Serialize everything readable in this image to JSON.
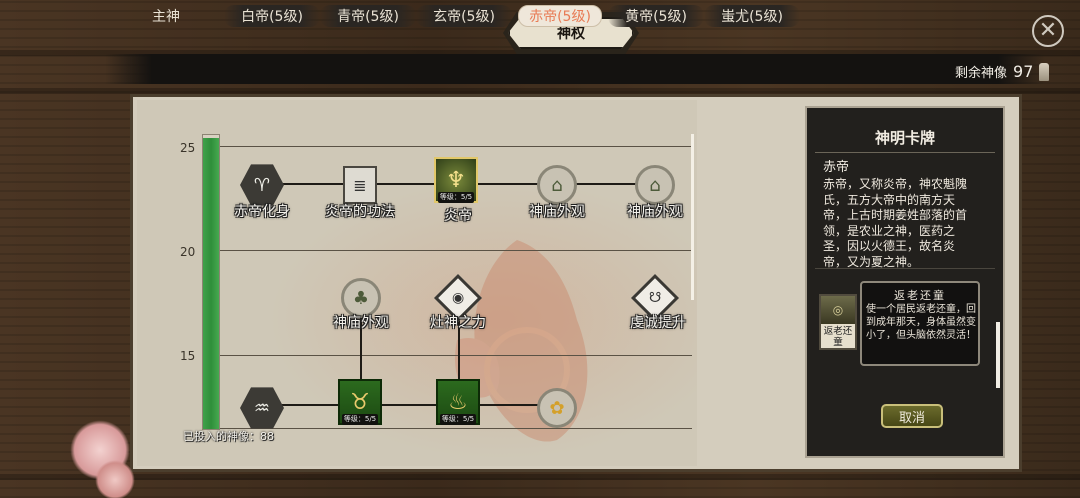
{
  "title": "神权",
  "tabs": [
    {
      "label": "主神",
      "active": false
    },
    {
      "label": "白帝(5级)",
      "active": false
    },
    {
      "label": "青帝(5级)",
      "active": false
    },
    {
      "label": "玄帝(5级)",
      "active": false
    },
    {
      "label": "赤帝(5级)",
      "active": true
    },
    {
      "label": "黄帝(5级)",
      "active": false
    },
    {
      "label": "蚩尤(5级)",
      "active": false
    }
  ],
  "remaining": {
    "label": "剩余神像",
    "value": "97"
  },
  "tree": {
    "levels": [
      "25",
      "20",
      "15"
    ],
    "progress": 0.99,
    "invested": "已投入的神像：88",
    "nodes": [
      {
        "label": "赤帝化身",
        "icon": "goat-icon"
      },
      {
        "label": "炎帝的功法",
        "icon": "scroll-icon"
      },
      {
        "label": "炎帝",
        "icon": "emperor-icon",
        "badge": "等级：5/5"
      },
      {
        "label": "神庙外观",
        "icon": "temple-icon"
      },
      {
        "label": "神庙外观",
        "icon": "temple-icon"
      },
      {
        "label": "神庙外观",
        "icon": "tree-icon"
      },
      {
        "label": "灶神之力",
        "icon": "stove-icon"
      },
      {
        "label": "虔诚提升",
        "icon": "hands-icon"
      },
      {
        "label": "",
        "icon": "dragon-icon"
      },
      {
        "label": "",
        "icon": "toad-icon",
        "badge": "等级：5/5"
      },
      {
        "label": "",
        "icon": "cauldron-icon",
        "badge": "等级：5/5"
      },
      {
        "label": "",
        "icon": "flower-icon"
      }
    ]
  },
  "card": {
    "header": "神明卡牌",
    "name": "赤帝",
    "description": "赤帝，又称炎帝，神农魁隗氏，五方大帝中的南方天帝，上古时期姜姓部落的首领，是农业之神，医药之圣，因以火德王，故名炎帝，又为夏之神。",
    "skill": {
      "icon_text": "返老还童",
      "title": "返老还童",
      "description": "使一个居民返老还童，回到成年那天，身体虽然变小了，但头脑依然灵活！"
    },
    "cancel": "取消"
  },
  "colors": {
    "active_tab_text": "#e87b55",
    "progress": "#3fa14a"
  }
}
